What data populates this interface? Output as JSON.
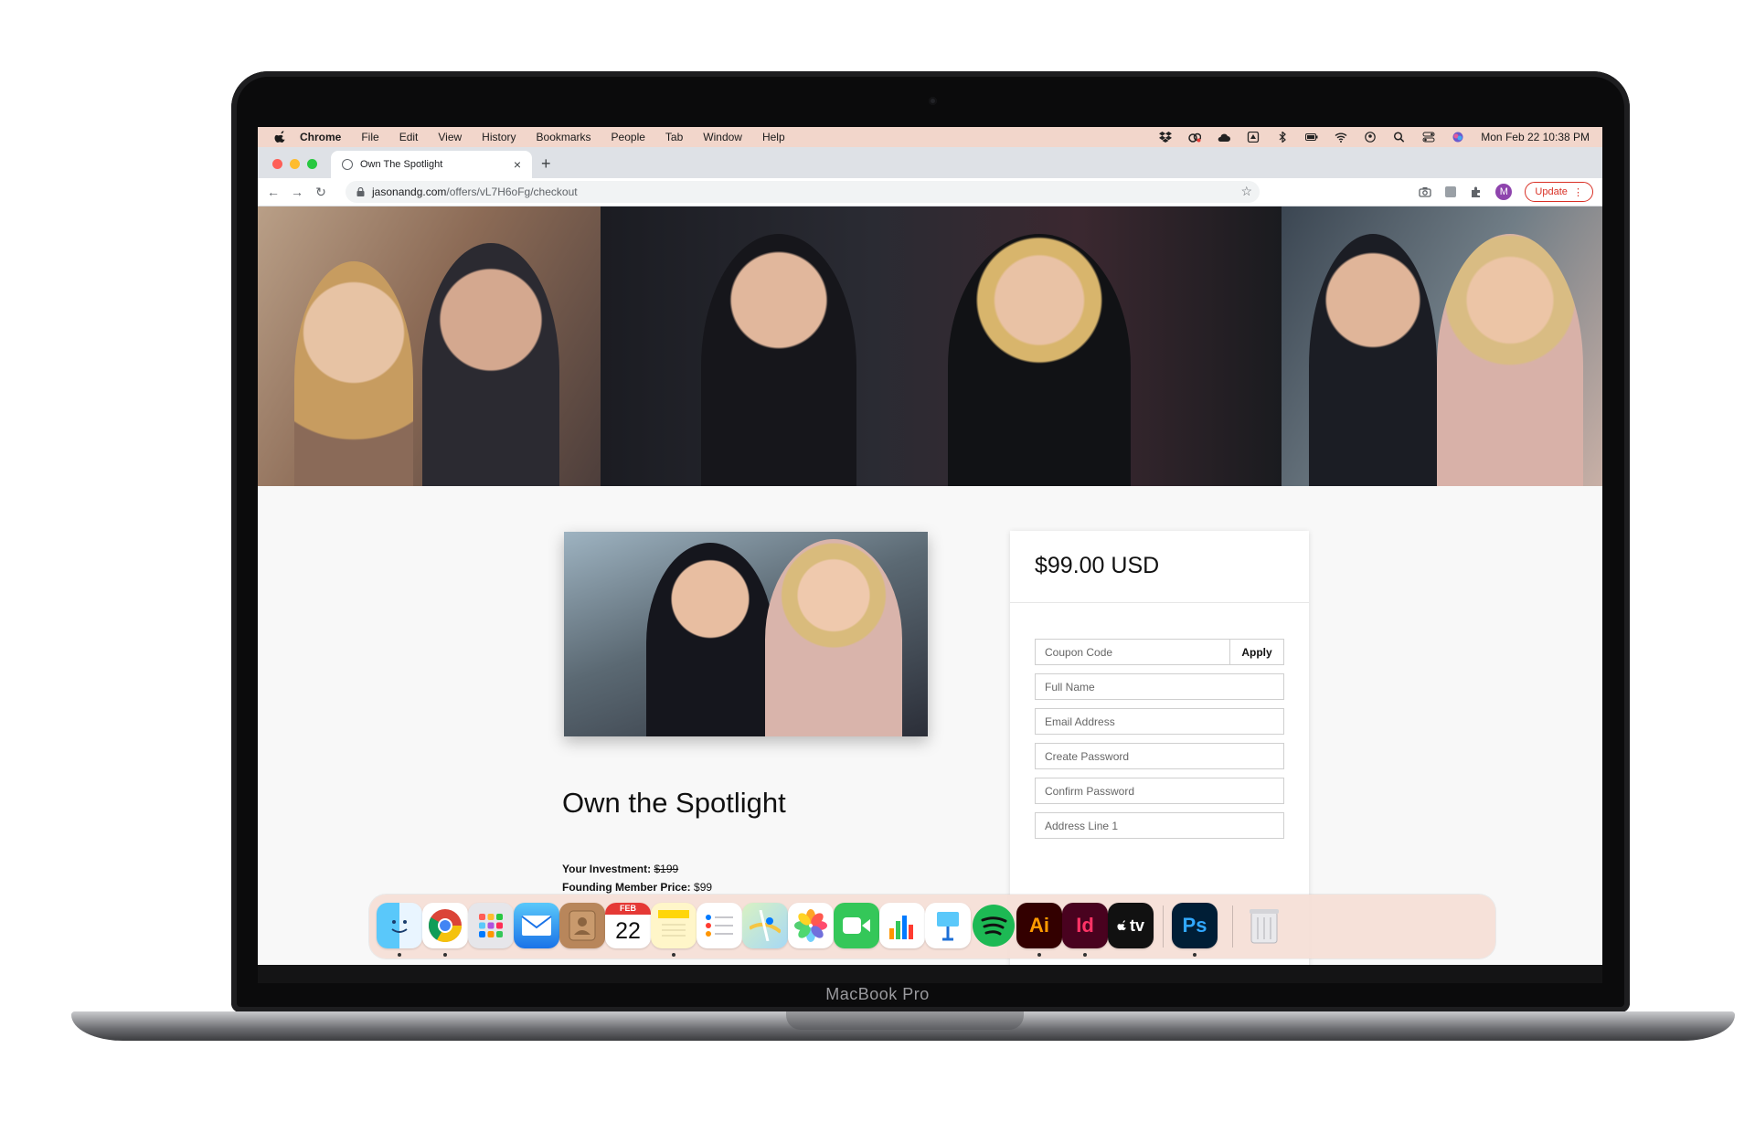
{
  "device": {
    "brand": "MacBook Pro"
  },
  "menubar": {
    "app": "Chrome",
    "items": [
      "File",
      "Edit",
      "View",
      "History",
      "Bookmarks",
      "People",
      "Tab",
      "Window",
      "Help"
    ],
    "datetime": "Mon Feb 22  10:38 PM",
    "status_icons": [
      "dropbox-icon",
      "creative-cloud-icon",
      "cloud-upload-icon",
      "square-app-icon",
      "bluetooth-icon",
      "battery-icon",
      "wifi-icon",
      "user-switch-icon",
      "spotlight-search-icon",
      "control-center-icon",
      "siri-icon"
    ]
  },
  "browser": {
    "tab_title": "Own The Spotlight",
    "new_tab": "+",
    "close": "×",
    "url_host": "jasonandg.com",
    "url_path": "/offers/vL7H6oFg/checkout",
    "profile_initial": "M",
    "update_label": "Update",
    "nav": {
      "back": "←",
      "forward": "→",
      "reload": "↻"
    },
    "star": "☆"
  },
  "page": {
    "product_title": "Own the Spotlight",
    "investment_label": "Your Investment:",
    "investment_old": "$199",
    "founding_label": "Founding Member Price:",
    "founding_price": "$99"
  },
  "checkout": {
    "price": "$99.00 USD",
    "coupon_placeholder": "Coupon Code",
    "apply_label": "Apply",
    "full_name_placeholder": "Full Name",
    "email_placeholder": "Email Address",
    "password_placeholder": "Create Password",
    "confirm_placeholder": "Confirm Password",
    "address_placeholder": "Address Line 1"
  },
  "dock": {
    "calendar_month": "FEB",
    "calendar_day": "22",
    "apps": [
      "finder-icon",
      "chrome-icon",
      "launchpad-icon",
      "mail-icon",
      "contacts-icon",
      "calendar-icon",
      "notes-icon",
      "reminders-icon",
      "maps-icon",
      "photos-icon",
      "facetime-icon",
      "numbers-icon",
      "keynote-icon",
      "spotify-icon",
      "illustrator-icon",
      "indesign-icon",
      "apple-tv-icon",
      "photoshop-icon",
      "trash-icon"
    ],
    "illustrator_label": "Ai",
    "indesign_label": "Id",
    "tv_label": "tv",
    "photoshop_label": "Ps"
  },
  "colors": {
    "menubar_bg": "#f2d6cb",
    "update_red": "#d93025",
    "profile_purple": "#8e44ad",
    "page_bg": "#f8f8f8"
  }
}
